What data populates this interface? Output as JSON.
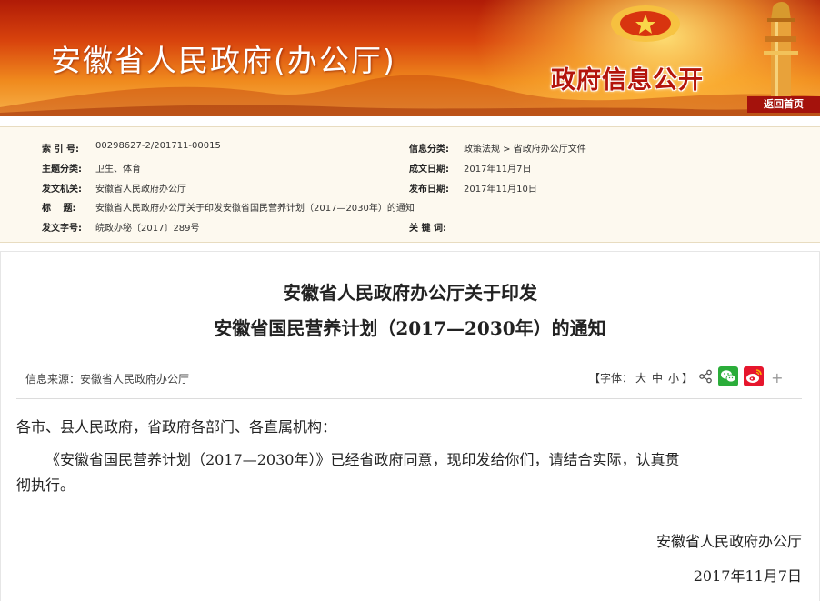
{
  "header": {
    "site_title": "安徽省人民政府(办公厅)",
    "disclosure": "政府信息公开",
    "return_home": "返回首页"
  },
  "meta": {
    "index_no_label": "索 引 号:",
    "index_no": "00298627-2/201711-00015",
    "category_label": "信息分类:",
    "category": "政策法规 > 省政府办公厅文件",
    "topic_label": "主题分类:",
    "topic": "卫生、体育",
    "created_label": "成文日期:",
    "created": "2017年11月7日",
    "issuer_label": "发文机关:",
    "issuer": "安徽省人民政府办公厅",
    "published_label": "发布日期:",
    "published": "2017年11月10日",
    "title_label": "标　 题:",
    "title": "安徽省人民政府办公厅关于印发安徽省国民营养计划（2017—2030年）的通知",
    "doc_no_label": "发文字号:",
    "doc_no": "皖政办秘〔2017〕289号",
    "keywords_label": "关 键 词:"
  },
  "article": {
    "title_line1": "安徽省人民政府办公厅关于印发",
    "title_line2": "安徽省国民营养计划（2017—2030年）的通知",
    "source": "信息来源：安徽省人民政府办公厅",
    "font_open": "【字体：",
    "font_large": "大",
    "font_medium": "中",
    "font_small": "小",
    "font_close": "】",
    "salutation": "各市、县人民政府，省政府各部门、各直属机构：",
    "para1_line1": "《安徽省国民营养计划（2017—2030年）》已经省政府同意，现印发给你们，请结合实际，认真贯",
    "para1_line2": "彻执行。",
    "signature": "安徽省人民政府办公厅",
    "date": "2017年11月7日"
  },
  "icons": {
    "share": "share-icon",
    "wechat": "wechat-icon",
    "weibo": "weibo-icon",
    "more": "plus-icon"
  },
  "colors": {
    "banner_red": "#b01b07",
    "banner_orange": "#f08b1e",
    "wechat_green": "#2bad3a",
    "weibo_red": "#e6162d"
  }
}
